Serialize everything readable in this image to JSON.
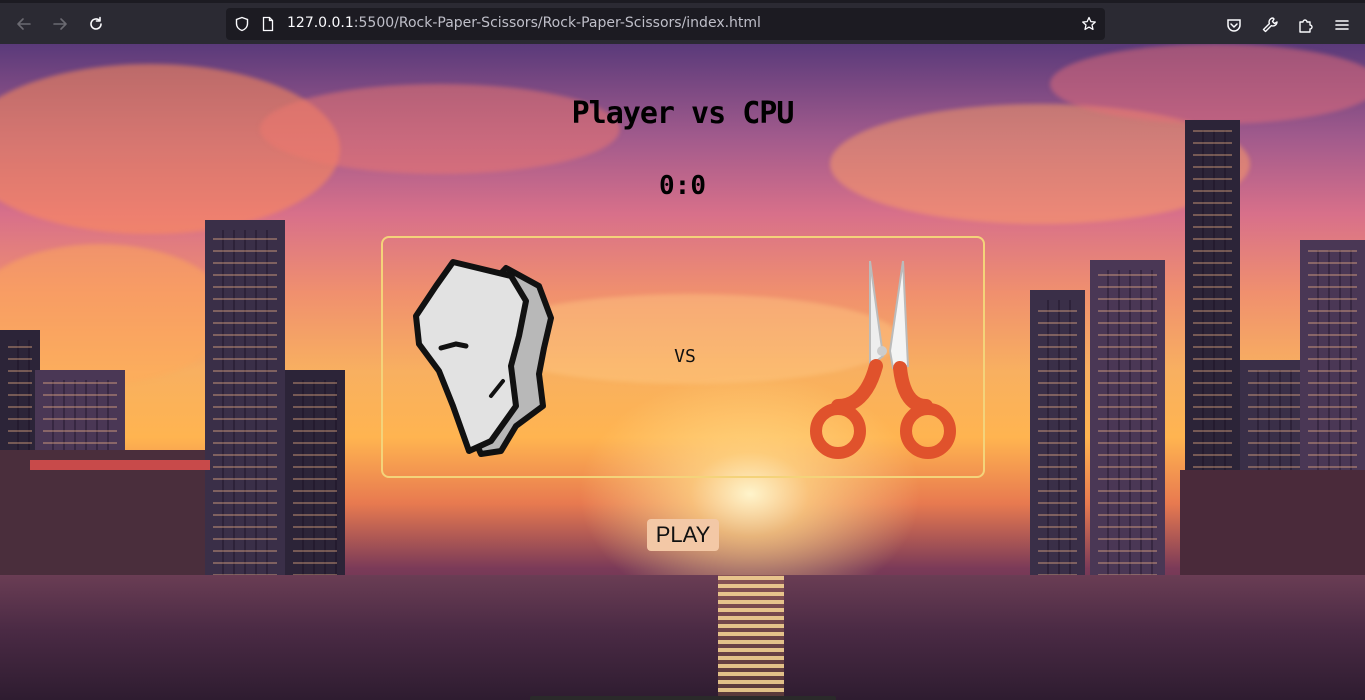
{
  "browser": {
    "url_host": "127.0.0.1",
    "url_path": ":5500/Rock-Paper-Scissors/Rock-Paper-Scissors/index.html"
  },
  "game": {
    "title": "Player vs CPU",
    "score": "0:0",
    "vs_label": "VS",
    "play_label": "PLAY",
    "player_choice": "rock",
    "cpu_choice": "scissors"
  },
  "colors": {
    "arena_border": "#f4d37a",
    "play_button_bg": "#f3c8a6",
    "chrome_bg": "#2b2a33"
  }
}
